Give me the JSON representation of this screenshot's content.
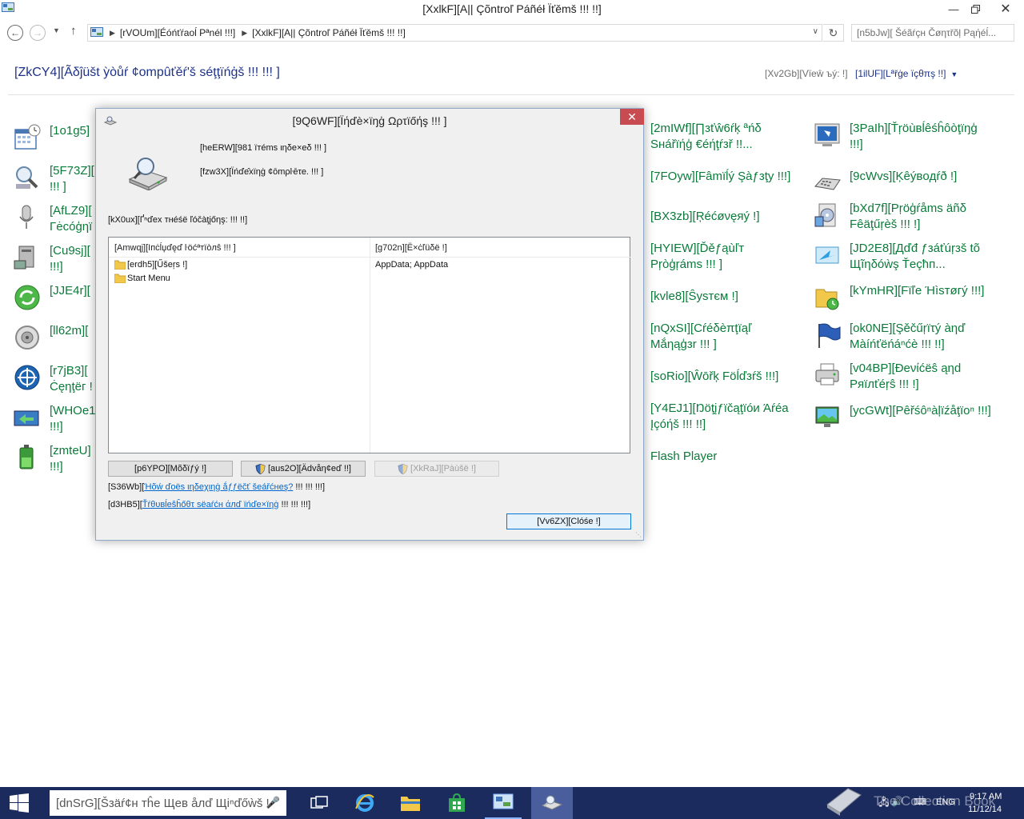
{
  "window": {
    "title": "[XxlkF][A|| Çõntroľ Páñéł Ïťěmš !!! !!]"
  },
  "address_bar": {
    "crumbs": [
      "[rVOUm][Éóńťŕaoĺ Pªnél !!!]",
      "[XxlkF][A|| Çõntroľ Páñéł Ïťěmš !!! !!]"
    ],
    "search_placeholder": "[n5bJw][ Šéãŕçн Čøητřõļ Pąήéĺ..."
  },
  "header": {
    "heading": "[ZkCY4][Ãδĵüšt ỳòůŕ ¢ompûťěŕ'š séţţïńģš !!! !!! ]",
    "view_by_label": "[Xv2Gb][Vïeŵ ъý: !]",
    "view_by_value": "[1ilUF][Lªřġe ïçθπş !!]"
  },
  "items_left": [
    {
      "label": "[1o1g5]",
      "icon": "date-time-icon"
    },
    {
      "label": "[5F73Z][",
      "label2": "!!! ]",
      "icon": "ease-of-access-icon"
    },
    {
      "label": "[AfLZ9][",
      "label2": "Γėсóģηї",
      "icon": "speech-recognition-icon"
    },
    {
      "label": "[Cu9sj][",
      "label2": "!!!]",
      "icon": "programs-computer-icon"
    },
    {
      "label": "[JJE4r][",
      "icon": "sync-center-icon"
    },
    {
      "label": "[ll62m][",
      "icon": "sound-icon"
    },
    {
      "label": "[r7jB3][",
      "label2": "Ċęηţёг !",
      "icon": "mobility-center-icon"
    },
    {
      "label": "[WHOe1",
      "label2": "!!!]",
      "icon": "work-folders-sync-icon"
    },
    {
      "label": "[zmteU]",
      "label2": "!!!]",
      "icon": "power-options-icon"
    }
  ],
  "items_mid": [
    {
      "label": "[2mIWf][∏зťŵ6ŕķ ªńδ",
      "label2": "Sнářïήģ €éήţŕзř !!...",
      "icon": ""
    },
    {
      "label": "[7FOyw][Fâmïĺý Şàƒзţу !!!]",
      "icon": ""
    },
    {
      "label": "[BX3zb][Ŗéćøνęяý !]",
      "icon": ""
    },
    {
      "label": "[HYIEW][Ďěƒąùľт",
      "label2": "Ρŗòģŗáms !!! ]",
      "icon": ""
    },
    {
      "label": "[kvle8][Ŝуѕтєм !]",
      "icon": ""
    },
    {
      "label": "[nQxSI][Cŕéδèπţïąľ",
      "label2": "Mắηąģзr !!! ]",
      "icon": ""
    },
    {
      "label": "[soRio][Ŵōřķ Föĺďзŕš !!!]",
      "icon": ""
    },
    {
      "label": "[Y4EJ1][Ŋöţįƒïčąţïóи Άŕéа",
      "label2": "Įçóήš !!! !!]",
      "icon": ""
    },
    {
      "label": "Flash Player",
      "icon": ""
    }
  ],
  "items_right": [
    {
      "label": "[3PaIh][Ťŗöùвĺêśĥôòţïŋģ",
      "label2": "!!!]",
      "icon": "troubleshooting-icon"
    },
    {
      "label": "[9cWvs][Ķêýвoдŕð !]",
      "icon": "keyboard-icon"
    },
    {
      "label": "[bXd7f][Ρŗöģŕåms äñδ",
      "label2": "Fêäţűŗèš !!! !]",
      "icon": "programs-features-icon"
    },
    {
      "label": "[JD2E8][Дďđ ƒзáťúŗзš tõ",
      "label2": "Щĩηδóẁş Ťеçħп...",
      "icon": "add-features-icon"
    },
    {
      "label": "[kYmHR][Fïľe Ήìѕтøгý !!!]",
      "icon": "file-history-icon"
    },
    {
      "label": "[ok0NE][Şěčűŗїτý àηď",
      "label2": "Màíńťëńáⁿćè !!! !!]",
      "icon": "security-maintenance-icon"
    },
    {
      "label": "[v04BP][Ðеνίćёŝ ąηd",
      "label2": "Ρяїлťéŗŝ !!! !]",
      "icon": "devices-printers-icon"
    },
    {
      "label": "[ycGWt][Pêřśôⁿàļïźåţïoⁿ !!!]",
      "icon": "personalization-icon"
    }
  ],
  "dialog": {
    "title": "[9Q6WF][Ïήďè×ïŋģ Ωρτïőήş !!! ]",
    "items_indexed": "[heERW][981 ïтéms ιηδе×еδ !!! ]",
    "status": "[fzw3X][Ïńďе̂хïηġ ¢ōmρŀēτе. !!! ]",
    "locations_label": "[kX0ux][Ґⁿďеx тнéśё ľóčàţįőηş: !!! !!]",
    "columns": {
      "included": "[Amwqj][Ιпċĺџďęď ŀöćªтїòлŝ !!! ]",
      "exclude": "[g702n][Ё×ċľüδё !]"
    },
    "rows": [
      {
        "location": "[erdh5][Űšеŗs !]",
        "exclude": "AppData; AppData"
      },
      {
        "location": "Start Menu",
        "exclude": ""
      }
    ],
    "buttons": {
      "modify": "[p6YPO][Mõδïƒý !]",
      "advanced": "[aus2O][Ädvåη¢eď !!]",
      "pause": "[XkRaJ][Pàùšë !]",
      "close": "[Vv6ZX][Clóśе !]"
    },
    "help1_prefix": "[S36Wb][",
    "help1_link": "Ήõẃ ďoёѕ ιηδеχιηġ ắƒƒёčť šеářćнеş?",
    "help1_suffix": " !!! !!! !!!]",
    "help2_prefix": "[d3HB5][",
    "help2_link": "Ťŕθυвĺеŝĥőθτ ѕëaŕćн άлď ïńďе×ïηġ",
    "help2_suffix": " !!! !!! !!!]"
  },
  "taskbar": {
    "search_placeholder": "[dnSrG][Šзäŕ¢н тĥе Щев åлď Щіⁿďőẁš ! ",
    "watermark": "The Collection Book",
    "language": "ENG",
    "time": "9:17 AM",
    "date": "11/12/14"
  }
}
